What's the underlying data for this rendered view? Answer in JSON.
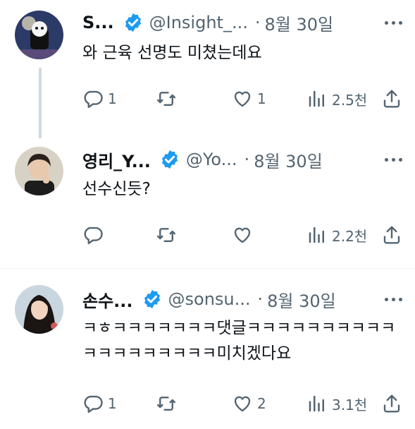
{
  "tweets": [
    {
      "name": "S...",
      "handle": "@Insight_...",
      "separator": "·",
      "date": "8월 30일",
      "text": "와 근육 선명도 미쳤는데요",
      "replies": "1",
      "retweets": "",
      "likes": "1",
      "views": "2.5천"
    },
    {
      "name": "영리_Y...",
      "handle": "@Yo...",
      "separator": "·",
      "date": "8월 30일",
      "text": "선수신듯?",
      "replies": "",
      "retweets": "",
      "likes": "",
      "views": "2.2천"
    },
    {
      "name": "손수...",
      "handle": "@sonsu...",
      "separator": "·",
      "date": "8월 30일",
      "text": "ㅋㅎㅋㅋㅋㅋㅋㅋㅋ댓글ㅋㅋㅋㅋㅋㅋㅋㅋㅋㅋㅋㅋㅋㅋㅋㅋㅋㅋㅋ미치겠다요",
      "replies": "1",
      "retweets": "",
      "likes": "2",
      "views": "3.1천"
    }
  ],
  "icons": {
    "verified": "verified-badge-icon",
    "more": "more-icon",
    "reply": "reply-icon",
    "retweet": "retweet-icon",
    "like": "heart-icon",
    "views": "views-chart-icon",
    "share": "share-icon"
  },
  "colors": {
    "verified": "#1d9bf0",
    "secondary_text": "#536471",
    "thread_line": "#cfd9de"
  }
}
